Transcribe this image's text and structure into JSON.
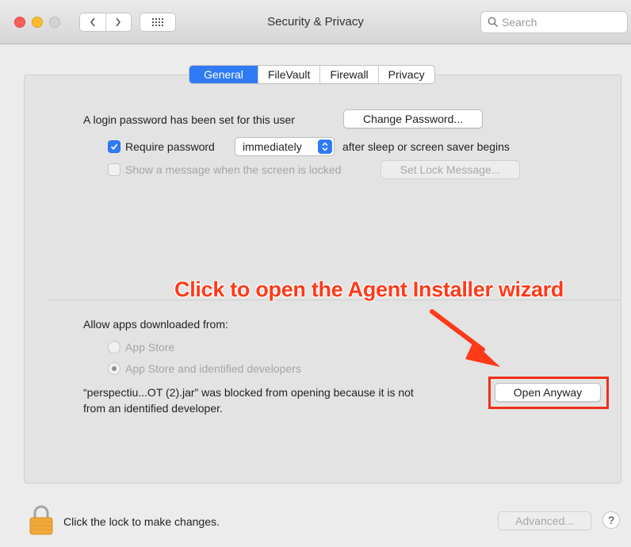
{
  "window": {
    "title": "Security & Privacy"
  },
  "search": {
    "placeholder": "Search"
  },
  "tabs": [
    {
      "label": "General",
      "active": true
    },
    {
      "label": "FileVault",
      "active": false
    },
    {
      "label": "Firewall",
      "active": false
    },
    {
      "label": "Privacy",
      "active": false
    }
  ],
  "general": {
    "login_text": "A login password has been set for this user",
    "change_password_label": "Change Password...",
    "require_password_label": "Require password",
    "require_password_checked": true,
    "require_password_value": "immediately",
    "after_sleep_text": "after sleep or screen saver begins",
    "show_message_label": "Show a message when the screen is locked",
    "show_message_checked": false,
    "set_lock_message_label": "Set Lock Message..."
  },
  "annotation": {
    "text": "Click to open the Agent Installer wizard",
    "color": "#ff3a19"
  },
  "downloads": {
    "heading": "Allow apps downloaded from:",
    "options": [
      {
        "label": "App Store",
        "selected": false
      },
      {
        "label": "App Store and identified developers",
        "selected": true
      }
    ],
    "blocked_line1": "“perspectiu...OT (2).jar” was blocked from opening because it is not",
    "blocked_line2": "from an identified developer.",
    "open_anyway_label": "Open Anyway"
  },
  "footer": {
    "lock_text": "Click the lock to make changes.",
    "advanced_label": "Advanced...",
    "help_label": "?"
  },
  "colors": {
    "accent": "#2f7bf5",
    "highlight_red": "#ef3017"
  },
  "icons": [
    "back-chevron-icon",
    "forward-chevron-icon",
    "grid-icon",
    "search-icon",
    "checkmark-icon",
    "stepper-icon",
    "lock-icon",
    "arrow-icon"
  ]
}
